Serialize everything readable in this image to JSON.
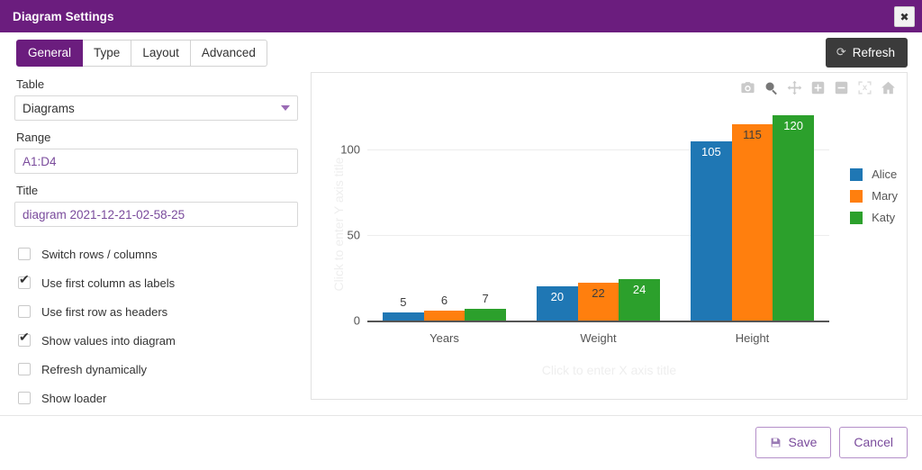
{
  "window": {
    "title": "Diagram Settings",
    "close_label": "✖"
  },
  "tabs": [
    {
      "label": "General",
      "active": true
    },
    {
      "label": "Type",
      "active": false
    },
    {
      "label": "Layout",
      "active": false
    },
    {
      "label": "Advanced",
      "active": false
    }
  ],
  "toolbar": {
    "refresh_label": "Refresh",
    "refresh_icon": "refresh-icon"
  },
  "form": {
    "table": {
      "label": "Table",
      "value": "Diagrams",
      "options": [
        "Diagrams"
      ]
    },
    "range": {
      "label": "Range",
      "value": "A1:D4",
      "placeholder": "A1:D4"
    },
    "title": {
      "label": "Title",
      "value": "diagram 2021-12-21-02-58-25",
      "placeholder": "Title"
    },
    "checkboxes": [
      {
        "label": "Switch rows / columns",
        "checked": false
      },
      {
        "label": "Use first column as labels",
        "checked": true
      },
      {
        "label": "Use first row as headers",
        "checked": false
      },
      {
        "label": "Show values into diagram",
        "checked": true
      },
      {
        "label": "Refresh dynamically",
        "checked": false
      },
      {
        "label": "Show loader",
        "checked": false
      }
    ]
  },
  "chart_modebar": [
    {
      "name": "download-camera-icon",
      "state": "normal"
    },
    {
      "name": "zoom-magnifier-icon",
      "state": "active"
    },
    {
      "name": "pan-move-icon",
      "state": "normal"
    },
    {
      "name": "zoom-in-icon",
      "state": "normal"
    },
    {
      "name": "zoom-out-icon",
      "state": "normal"
    },
    {
      "name": "autoscale-icon",
      "state": "disabled"
    },
    {
      "name": "reset-home-icon",
      "state": "normal"
    }
  ],
  "chart_data": {
    "type": "bar",
    "title": "",
    "xlabel": "Click to enter X axis title",
    "ylabel": "Click to enter Y axis title",
    "categories": [
      "Years",
      "Weight",
      "Height"
    ],
    "series": [
      {
        "name": "Alice",
        "color": "#1f77b4",
        "values": [
          5,
          20,
          105
        ]
      },
      {
        "name": "Mary",
        "color": "#ff7f0e",
        "values": [
          6,
          22,
          115
        ]
      },
      {
        "name": "Katy",
        "color": "#2ca02c",
        "values": [
          7,
          24,
          120
        ]
      }
    ],
    "ylim": [
      0,
      130
    ],
    "yticks": [
      0,
      50,
      100
    ],
    "grid": true,
    "legend_position": "right",
    "show_values": true
  },
  "footer": {
    "save_label": "Save",
    "save_icon": "floppy-disk-icon",
    "cancel_label": "Cancel"
  }
}
